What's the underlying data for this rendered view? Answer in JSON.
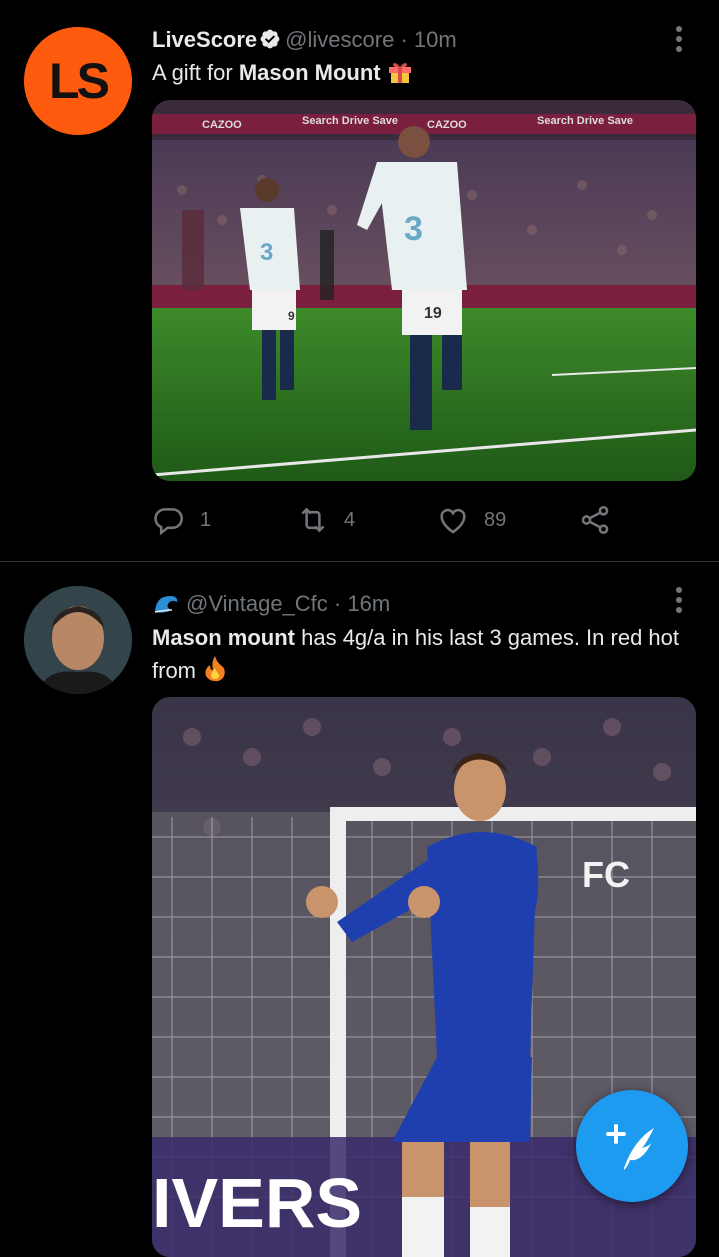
{
  "tweets": [
    {
      "name": "LiveScore",
      "handle": "@livescore",
      "dot": "·",
      "time": "10m",
      "text_prefix": "A gift for ",
      "text_bold": "Mason Mount",
      "avatar_text": "LS",
      "stats": {
        "replies": "1",
        "retweets": "4",
        "likes": "89"
      }
    },
    {
      "name": "",
      "handle": "@Vintage_Cfc",
      "dot": "·",
      "time": "16m",
      "text_bold": "Mason mount",
      "text_rest": " has 4g/a in his last 3 games. In red hot from "
    }
  ],
  "media_1": {
    "banner_texts": [
      "CAZOO",
      "Search Drive Save",
      "CAZOO",
      "Search Drive Save"
    ],
    "shirt_numbers": [
      "3",
      "9",
      "19"
    ]
  },
  "media_2": {
    "ad_text": "IVERS",
    "sign_text": "FC"
  },
  "colors": {
    "accent": "#1d9bf0",
    "livescore_orange": "#ff5b0f",
    "pitch": "#2f6e1f",
    "chelsea_blue": "#1f3fae"
  },
  "icons": [
    "verified-icon",
    "more-icon",
    "reply-icon",
    "retweet-icon",
    "like-icon",
    "share-icon",
    "wave-icon",
    "fire-icon",
    "gift-icon",
    "compose-icon"
  ]
}
